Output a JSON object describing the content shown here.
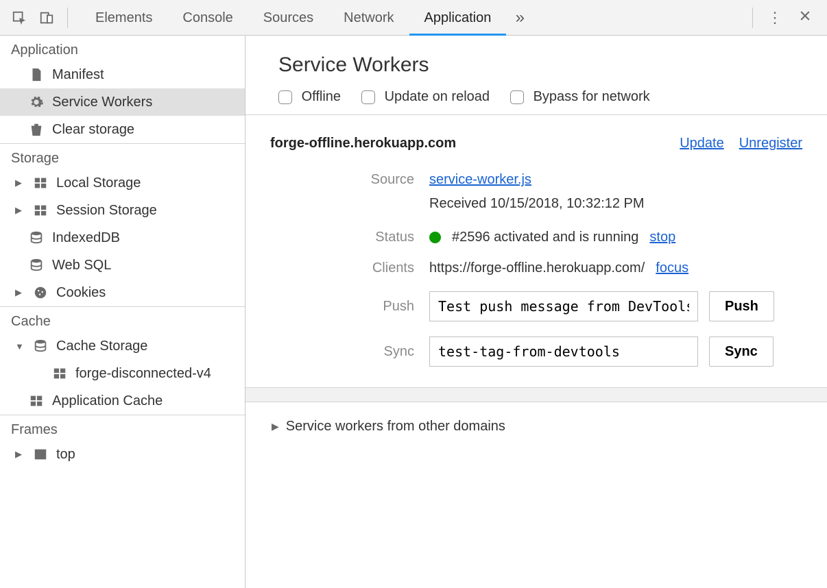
{
  "tabs": {
    "elements": "Elements",
    "console": "Console",
    "sources": "Sources",
    "network": "Network",
    "application": "Application"
  },
  "sidebar": {
    "application": {
      "title": "Application",
      "manifest": "Manifest",
      "service_workers": "Service Workers",
      "clear_storage": "Clear storage"
    },
    "storage": {
      "title": "Storage",
      "local_storage": "Local Storage",
      "session_storage": "Session Storage",
      "indexeddb": "IndexedDB",
      "websql": "Web SQL",
      "cookies": "Cookies"
    },
    "cache": {
      "title": "Cache",
      "cache_storage": "Cache Storage",
      "cache_entry": "forge-disconnected-v4",
      "application_cache": "Application Cache"
    },
    "frames": {
      "title": "Frames",
      "top": "top"
    }
  },
  "main": {
    "title": "Service Workers",
    "opts": {
      "offline": "Offline",
      "update_on_reload": "Update on reload",
      "bypass": "Bypass for network"
    },
    "origin": "forge-offline.herokuapp.com",
    "update": "Update",
    "unregister": "Unregister",
    "labels": {
      "source": "Source",
      "status": "Status",
      "clients": "Clients",
      "push": "Push",
      "sync": "Sync"
    },
    "source_link": "service-worker.js",
    "received_text": "Received 10/15/2018, 10:32:12 PM",
    "status_text": "#2596 activated and is running",
    "stop": "stop",
    "client_url": "https://forge-offline.herokuapp.com/",
    "focus": "focus",
    "push_value": "Test push message from DevTools",
    "push_btn": "Push",
    "sync_value": "test-tag-from-devtools",
    "sync_btn": "Sync",
    "other_domains": "Service workers from other domains"
  }
}
